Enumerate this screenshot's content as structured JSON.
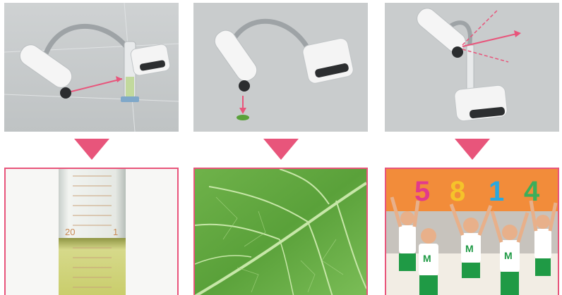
{
  "colors": {
    "accent": "#e8557b",
    "photo_bg": "#c9cccd",
    "device": "#f4f4f4",
    "leaf": "#5aa13a"
  },
  "labels": {
    "tube_mark_20": "20",
    "tube_mark_1": "1",
    "number_board": [
      "5",
      "8",
      "1",
      "4"
    ]
  }
}
